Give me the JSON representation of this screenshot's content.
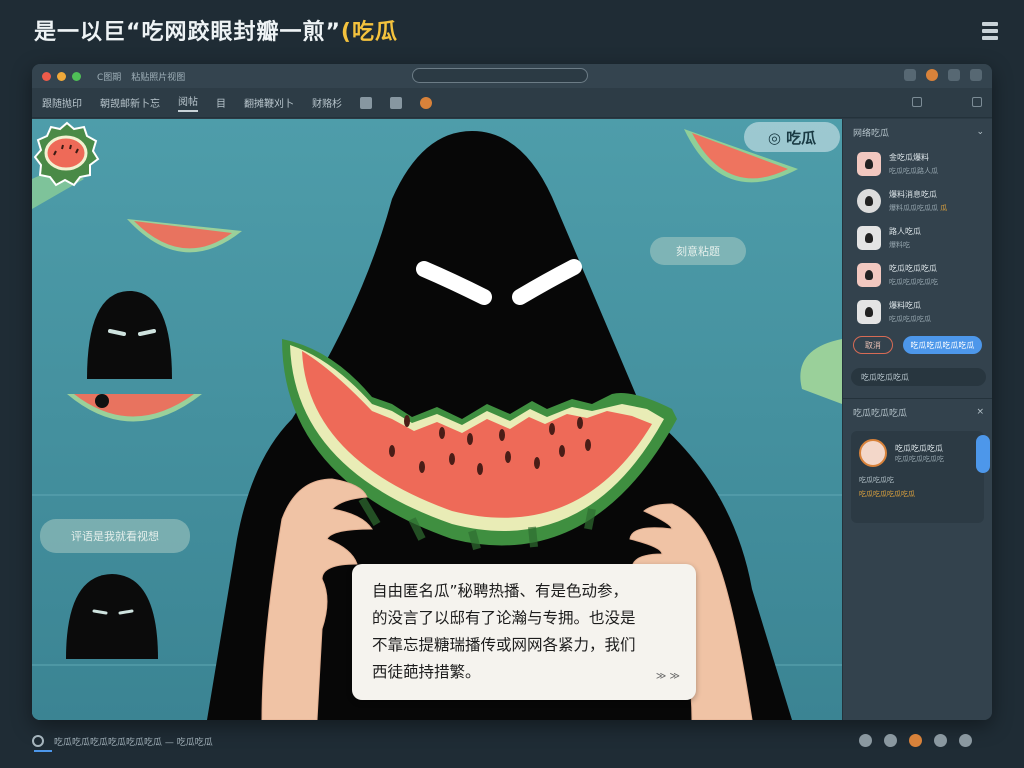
{
  "page": {
    "title_main": "是一以巨“吃网跤眼封瓣一煎”",
    "title_highlight": "(吃瓜"
  },
  "window": {
    "tab_label": "C图期",
    "tab_label_2": "粘贴照片视图",
    "toolbar": {
      "items": [
        {
          "label": "跟随抛印"
        },
        {
          "label": "朝觊邮新卜忘"
        },
        {
          "label": "阅帖",
          "active": true
        },
        {
          "label": "目"
        },
        {
          "label": "翻摊鞭刈卜"
        },
        {
          "label": "财赂杉"
        }
      ]
    }
  },
  "stage": {
    "watermark": "◎ 吃瓜",
    "bubble_right": "刻意粘题",
    "bubble_left": "评语是我就看视想",
    "caption_lines": [
      "自由匿名瓜”秘聘热播、有是色动参，",
      "的没言了以邸有了论瀚与专拥。也没是",
      "不靠忘提糖瑞播传或网网各紧力，我们",
      "西徒葩持措繁。"
    ],
    "caption_more": "≫ ≫"
  },
  "sidebar": {
    "header": "网络吃瓜",
    "items": [
      {
        "name": "金吃瓜爆料",
        "meta": "吃瓜吃瓜路人瓜"
      },
      {
        "name": "爆料消息吃瓜",
        "meta": "爆料瓜瓜吃瓜瓜",
        "meta_hl": "瓜"
      },
      {
        "name": "路人吃瓜",
        "meta": "爆料吃"
      },
      {
        "name": "吃瓜吃瓜吃瓜",
        "meta": "吃瓜吃瓜吃瓜吃"
      },
      {
        "name": "爆料吃瓜",
        "meta": "吃瓜吃瓜吃瓜"
      }
    ],
    "btn_cancel": "取消",
    "btn_confirm": "吃瓜吃瓜吃瓜吃瓜",
    "search_bar": "吃瓜吃瓜吃瓜",
    "panel_header": "吃瓜吃瓜吃瓜",
    "card": {
      "title": "吃瓜吃瓜吃瓜",
      "subtitle": "吃瓜吃瓜吃瓜吃",
      "line": "吃瓜吃瓜吃",
      "line2": "吃瓜吃瓜吃瓜吃瓜"
    }
  },
  "status": {
    "text": "吃瓜吃瓜吃瓜吃瓜吃瓜吃瓜 — 吃瓜吃瓜"
  },
  "colors": {
    "background": "#1f2c35",
    "stage": "#3d8fa0",
    "accent_blue": "#4d97ea",
    "accent_orange": "#d8823a",
    "title_highlight": "#f4c23d",
    "watermelon_red": "#ee6a58"
  }
}
